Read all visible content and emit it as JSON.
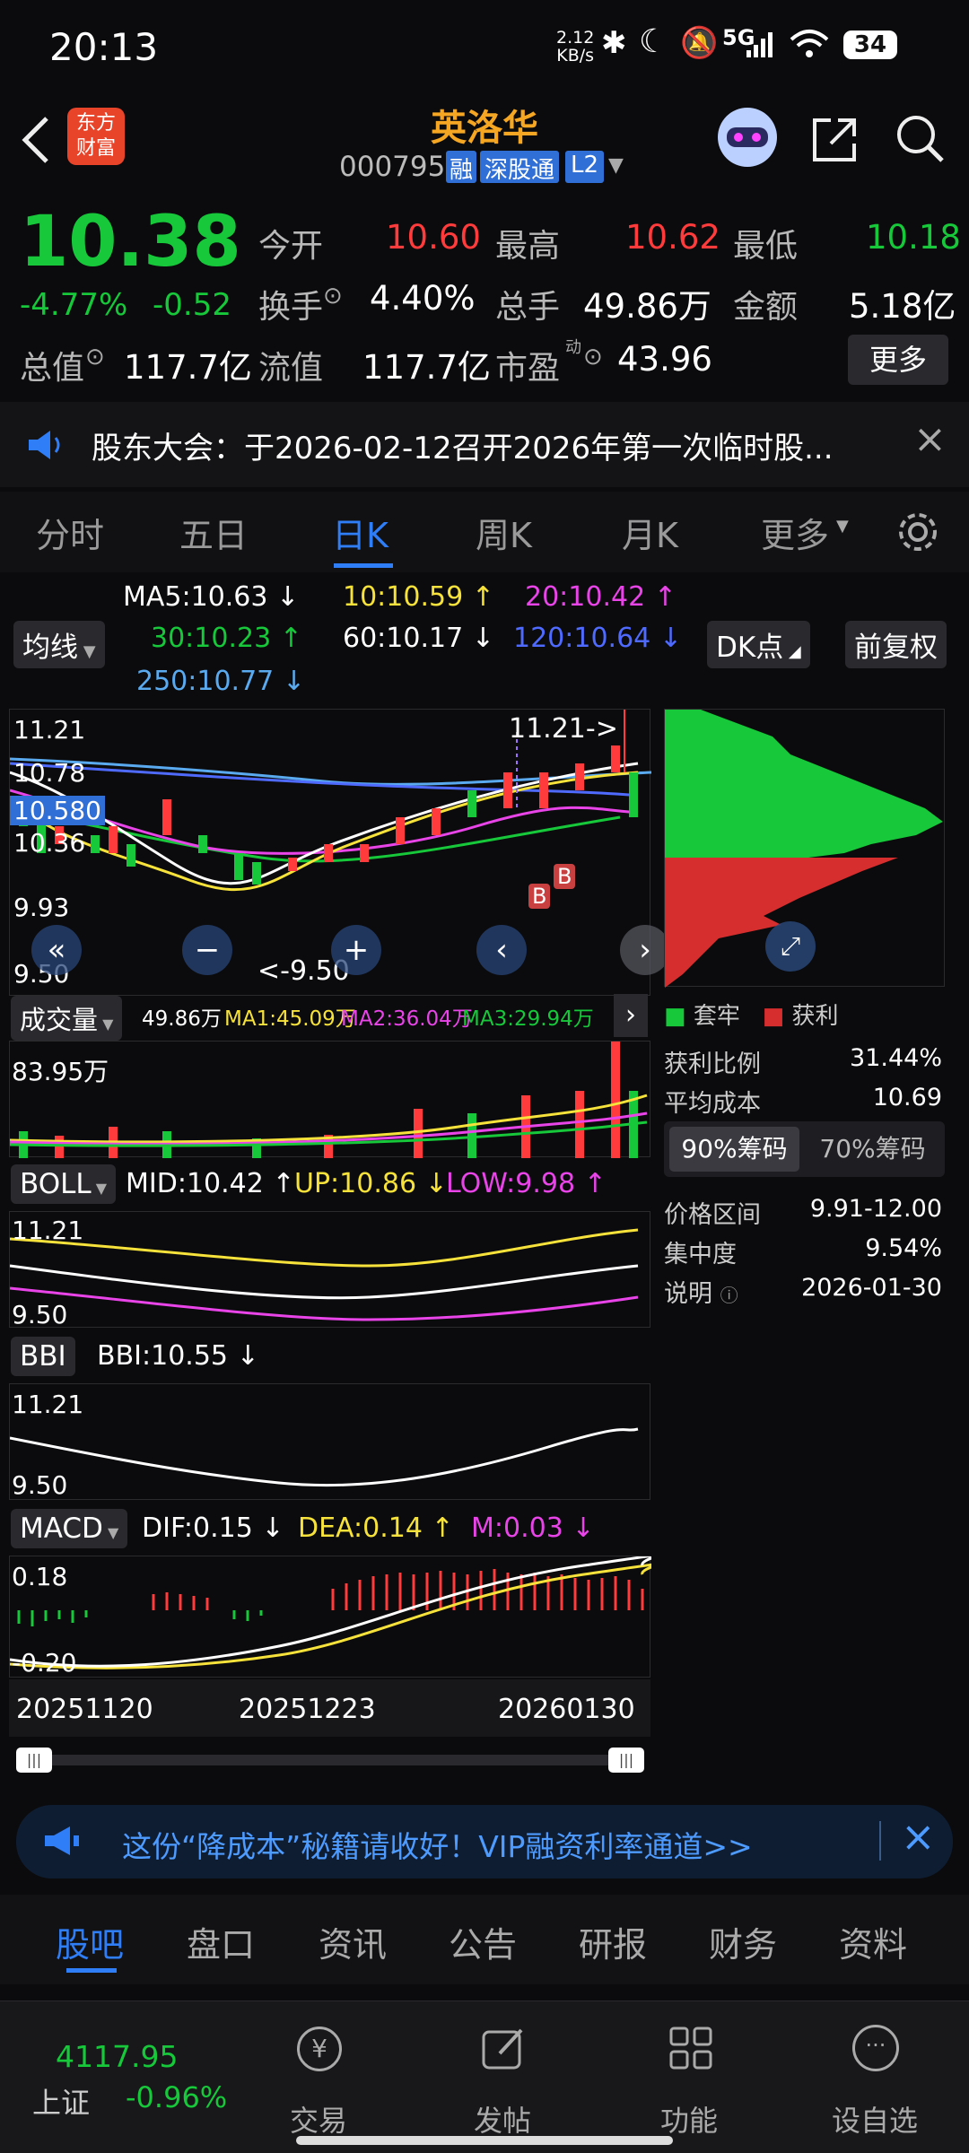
{
  "status_bar": {
    "time": "20:13",
    "net_speed_top": "2.12",
    "net_speed_bottom": "KB/s",
    "signal": "5G",
    "battery": "34"
  },
  "header": {
    "title": "英洛华",
    "code": "000795",
    "badges": [
      "融",
      "深股通",
      "L2"
    ],
    "brand_top": "东方",
    "brand_bottom": "财富"
  },
  "quote": {
    "price": "10.38",
    "change_pct": "-4.77%",
    "change": "-0.52",
    "fields": {
      "open_label": "今开",
      "open": "10.60",
      "high_label": "最高",
      "high": "10.62",
      "low_label": "最低",
      "low": "10.18",
      "turnover_label": "换手",
      "turnover": "4.40%",
      "volume_label": "总手",
      "volume": "49.86万",
      "amount_label": "金额",
      "amount": "5.18亿",
      "mcap_label": "总值",
      "mcap": "117.7亿",
      "float_label": "流值",
      "float": "117.7亿",
      "pe_label": "市盈",
      "pe_sup": "动",
      "pe": "43.96"
    },
    "more_button": "更多"
  },
  "notice": {
    "text": "股东大会：于2026-02-12召开2026年第一次临时股..."
  },
  "tabs": [
    {
      "label": "分时"
    },
    {
      "label": "五日"
    },
    {
      "label": "日K"
    },
    {
      "label": "周K"
    },
    {
      "label": "月K"
    },
    {
      "label": "更多"
    }
  ],
  "chart_controls": {
    "ma_toggle": "均线",
    "dk_button": "DK点",
    "adjust_button": "前复权"
  },
  "ma": {
    "ma5": "MA5:10.63",
    "ma10": "10:10.59",
    "ma20": "20:10.42",
    "ma30": "30:10.23",
    "ma60": "60:10.17",
    "ma120": "120:10.64",
    "ma250": "250:10.77",
    "arrow_down": "↓",
    "arrow_up": "↑"
  },
  "main_chart": {
    "y_top": "11.21",
    "y_mid1": "10.78",
    "current_price_tag": "10.580",
    "y_mid2": "10.36",
    "y_low1": "9.93",
    "y_bottom": "9.50",
    "max_marker": "11.21->",
    "min_marker": "<-9.50",
    "signal_b": "B"
  },
  "volume": {
    "label": "成交量",
    "value": "49.86万",
    "ma1": "MA1:45.09万",
    "ma2": "MA2:36.04万",
    "ma3": "MA3:29.94万",
    "y_top": "83.95万"
  },
  "boll": {
    "label": "BOLL",
    "mid": "MID:10.42",
    "up": "UP:10.86",
    "low": "LOW:9.98",
    "y_top": "11.21",
    "y_bottom": "9.50"
  },
  "bbi": {
    "label": "BBI",
    "value": "BBI:10.55",
    "y_top": "11.21",
    "y_bottom": "9.50"
  },
  "macd": {
    "label": "MACD",
    "dif": "DIF:0.15",
    "dea": "DEA:0.14",
    "m": "M:0.03",
    "y_top": "0.18",
    "y_bottom": "-0.20"
  },
  "x_axis": [
    "20251120",
    "20251223",
    "20260130"
  ],
  "chips": {
    "legend_trapped": "套牢",
    "legend_profit": "获利",
    "profit_ratio_label": "获利比例",
    "profit_ratio": "31.44%",
    "avg_cost_label": "平均成本",
    "avg_cost": "10.69",
    "tab_90": "90%筹码",
    "tab_70": "70%筹码",
    "range_label": "价格区间",
    "range": "9.91-12.00",
    "concentration_label": "集中度",
    "concentration": "9.54%",
    "note_label": "说明",
    "note_date": "2026-01-30"
  },
  "ad": {
    "text": "这份“降成本”秘籍请收好！VIP融资利率通道>>"
  },
  "bottom_tabs": [
    {
      "label": "股吧"
    },
    {
      "label": "盘口"
    },
    {
      "label": "资讯"
    },
    {
      "label": "公告"
    },
    {
      "label": "研报"
    },
    {
      "label": "财务"
    },
    {
      "label": "资料"
    }
  ],
  "bottom_bar": {
    "index_value": "4117.95",
    "index_name": "上证",
    "index_change": "-0.96%",
    "trade": "交易",
    "post": "发帖",
    "func": "功能",
    "watch": "设自选"
  },
  "colors": {
    "up": "#ff3b3b",
    "down": "#16c83a",
    "accent": "#2f7ef7",
    "title": "#f5a623",
    "ma5": "#ffffff",
    "ma10": "#f6e23a",
    "ma20": "#e844e8",
    "ma30": "#16c83a",
    "ma120": "#4f6bff",
    "ma250": "#5aaaf0"
  }
}
